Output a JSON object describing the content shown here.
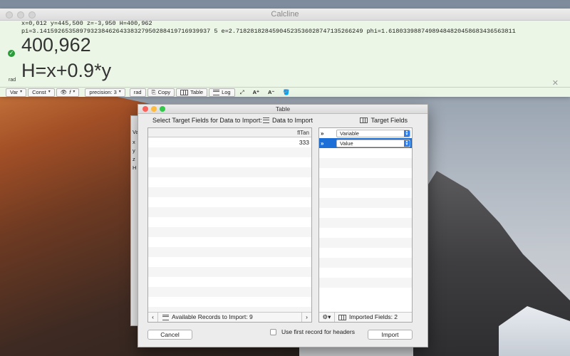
{
  "calcline": {
    "title": "Calcline",
    "variables_line": "x=0,012   y=445,500   z=-3,950   H=400,962",
    "constants_line": "pi=3.14159265358979323846264338327950288419716939937 5   e=2.71828182845904523536028747135266249   phi=1.61803398874989484820458683436563811",
    "result": "400,962",
    "expression": "H=x+0.9*y",
    "angle_mode": "rad",
    "toolbar": {
      "var": "Var",
      "const": "Const",
      "func": "f",
      "precision": "precision: 3",
      "rad": "rad",
      "copy": "Copy",
      "table": "Table",
      "log": "Log"
    }
  },
  "table_window": {
    "title": "Table",
    "instruction": "Select Target Fields for Data to Import:",
    "data_heading": "Data to Import",
    "target_heading": "Target Fields",
    "data_column_header": "flTan",
    "data_rows": [
      "333"
    ],
    "available_records": "Available Records to Import: 9",
    "imported_fields": "Imported Fields: 2",
    "target_rows": [
      {
        "arrows": "»",
        "field": "Variable"
      },
      {
        "arrows": "»",
        "field": "Value"
      }
    ],
    "cancel_label": "Cancel",
    "import_label": "Import",
    "first_record_label": "Use first record for headers",
    "first_record_checked": false
  },
  "behind": {
    "labels": [
      "Va",
      "x",
      "y",
      "z",
      "H"
    ]
  }
}
